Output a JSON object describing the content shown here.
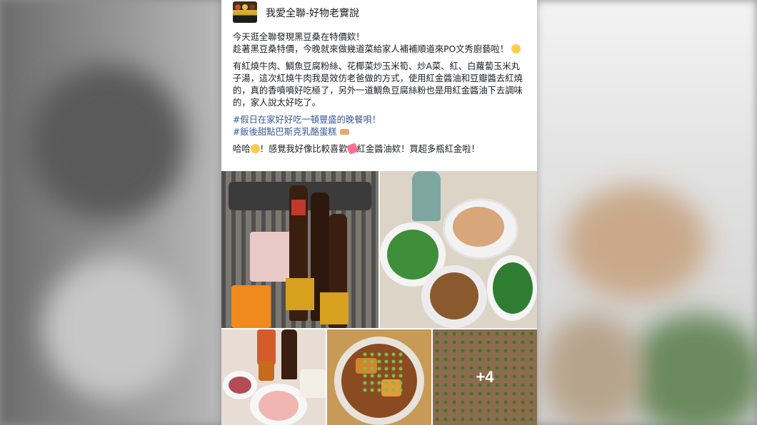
{
  "group": {
    "name": "我愛全聯-好物老實說"
  },
  "post": {
    "paragraph1_line1": "今天逛全聯發現黑豆桑在特價欸！",
    "paragraph1_line2": "趁著黑豆桑特價，今晚就來做幾道菜給家人補補順道來PO文秀廚藝啦！",
    "paragraph2": "有紅燒牛肉、鯛魚豆腐粉絲、花椰菜炒玉米筍、炒A菜、紅、白蘿蔔玉米丸子湯，這次紅燒牛肉我是效仿老爸做的方式，使用紅金醬油和豆瓣醬去紅燒的，真的香噴噴好吃極了，另外一道鯛魚豆腐絲粉也是用紅金醬油下去調味的，家人說太好吃了。",
    "hashtag1": "#假日在家好好吃一頓豐盛的晚餐唄！",
    "hashtag2": "#飯後甜點巴斯克乳酪蛋糕",
    "paragraph3_a": "哈哈",
    "paragraph3_b": "！感覺我好像比較喜歡",
    "paragraph3_c": "紅金醬油欸！買超多瓶紅金啦！"
  },
  "photos": {
    "more_label": "+4"
  },
  "icons": {
    "emoji_smile": "smiling-face-emoji",
    "emoji_heart": "hearts-emoji",
    "emoji_cake": "cake-emoji"
  },
  "colors": {
    "hashtag": "#385898",
    "text": "#1c1e21",
    "card": "#ffffff"
  }
}
